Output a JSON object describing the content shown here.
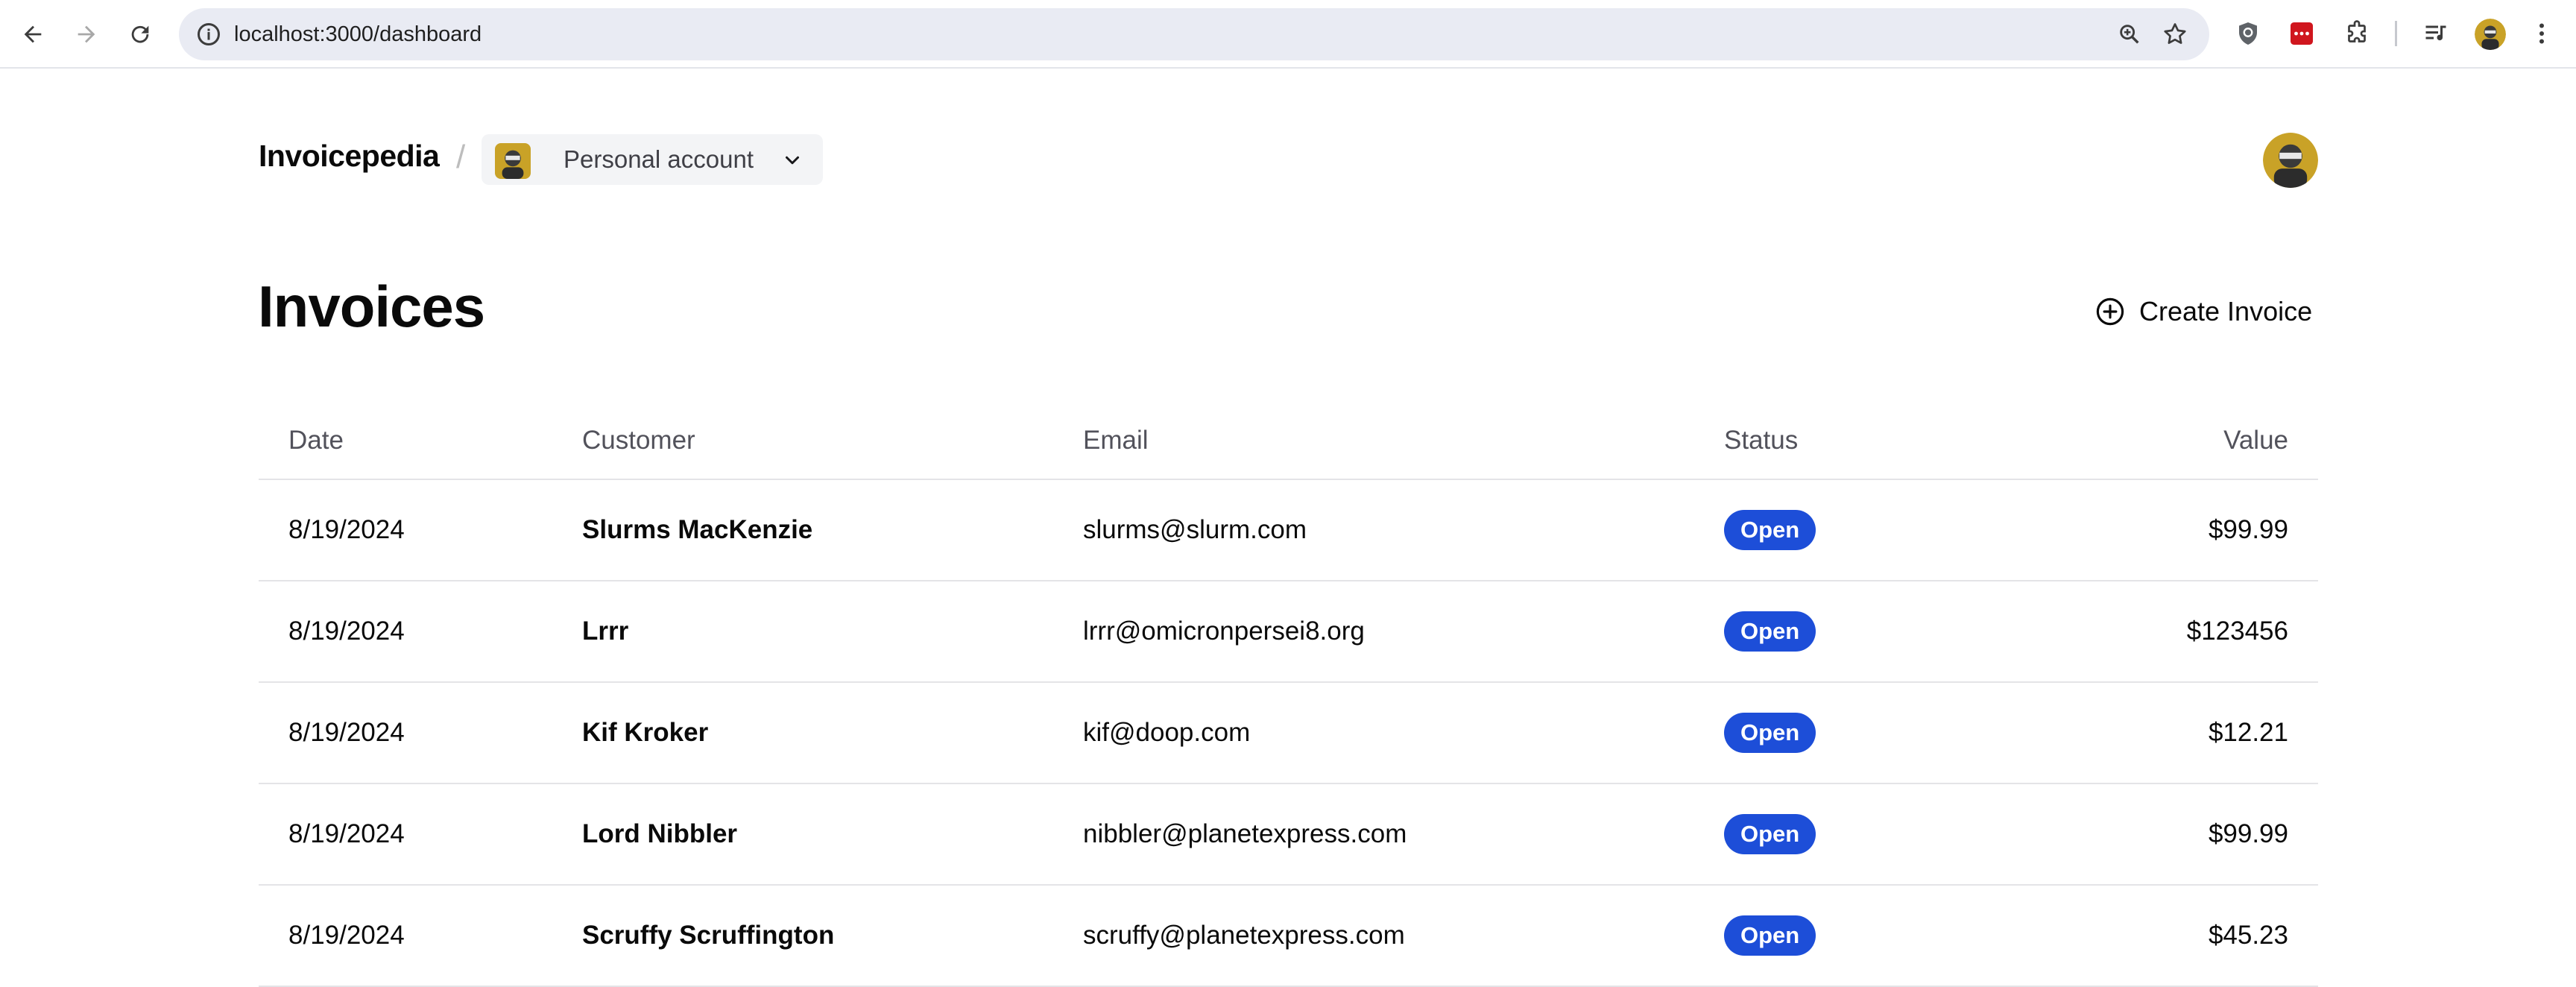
{
  "browser": {
    "url": "localhost:3000/dashboard"
  },
  "header": {
    "brand": "Invoicepedia",
    "separator": "/",
    "account_label": "Personal account"
  },
  "page": {
    "title": "Invoices",
    "create_label": "Create Invoice"
  },
  "table": {
    "headers": {
      "date": "Date",
      "customer": "Customer",
      "email": "Email",
      "status": "Status",
      "value": "Value"
    },
    "rows": [
      {
        "date": "8/19/2024",
        "customer": "Slurms MacKenzie",
        "email": "slurms@slurm.com",
        "status": "Open",
        "value": "$99.99"
      },
      {
        "date": "8/19/2024",
        "customer": "Lrrr",
        "email": "lrrr@omicronpersei8.org",
        "status": "Open",
        "value": "$123456"
      },
      {
        "date": "8/19/2024",
        "customer": "Kif Kroker",
        "email": "kif@doop.com",
        "status": "Open",
        "value": "$12.21"
      },
      {
        "date": "8/19/2024",
        "customer": "Lord Nibbler",
        "email": "nibbler@planetexpress.com",
        "status": "Open",
        "value": "$99.99"
      },
      {
        "date": "8/19/2024",
        "customer": "Scruffy Scruffington",
        "email": "scruffy@planetexpress.com",
        "status": "Open",
        "value": "$45.23"
      }
    ]
  },
  "colors": {
    "status_open": "#1d4ed8",
    "muted_text": "#52525b",
    "divider": "#e4e4e7"
  },
  "icons": {
    "back": "arrow-left-icon",
    "forward": "arrow-right-icon",
    "reload": "reload-icon",
    "site_info": "info-icon",
    "zoom": "zoom-icon",
    "bookmark": "star-icon",
    "create": "plus-circle-icon",
    "account_menu": "chevron-down-icon"
  }
}
